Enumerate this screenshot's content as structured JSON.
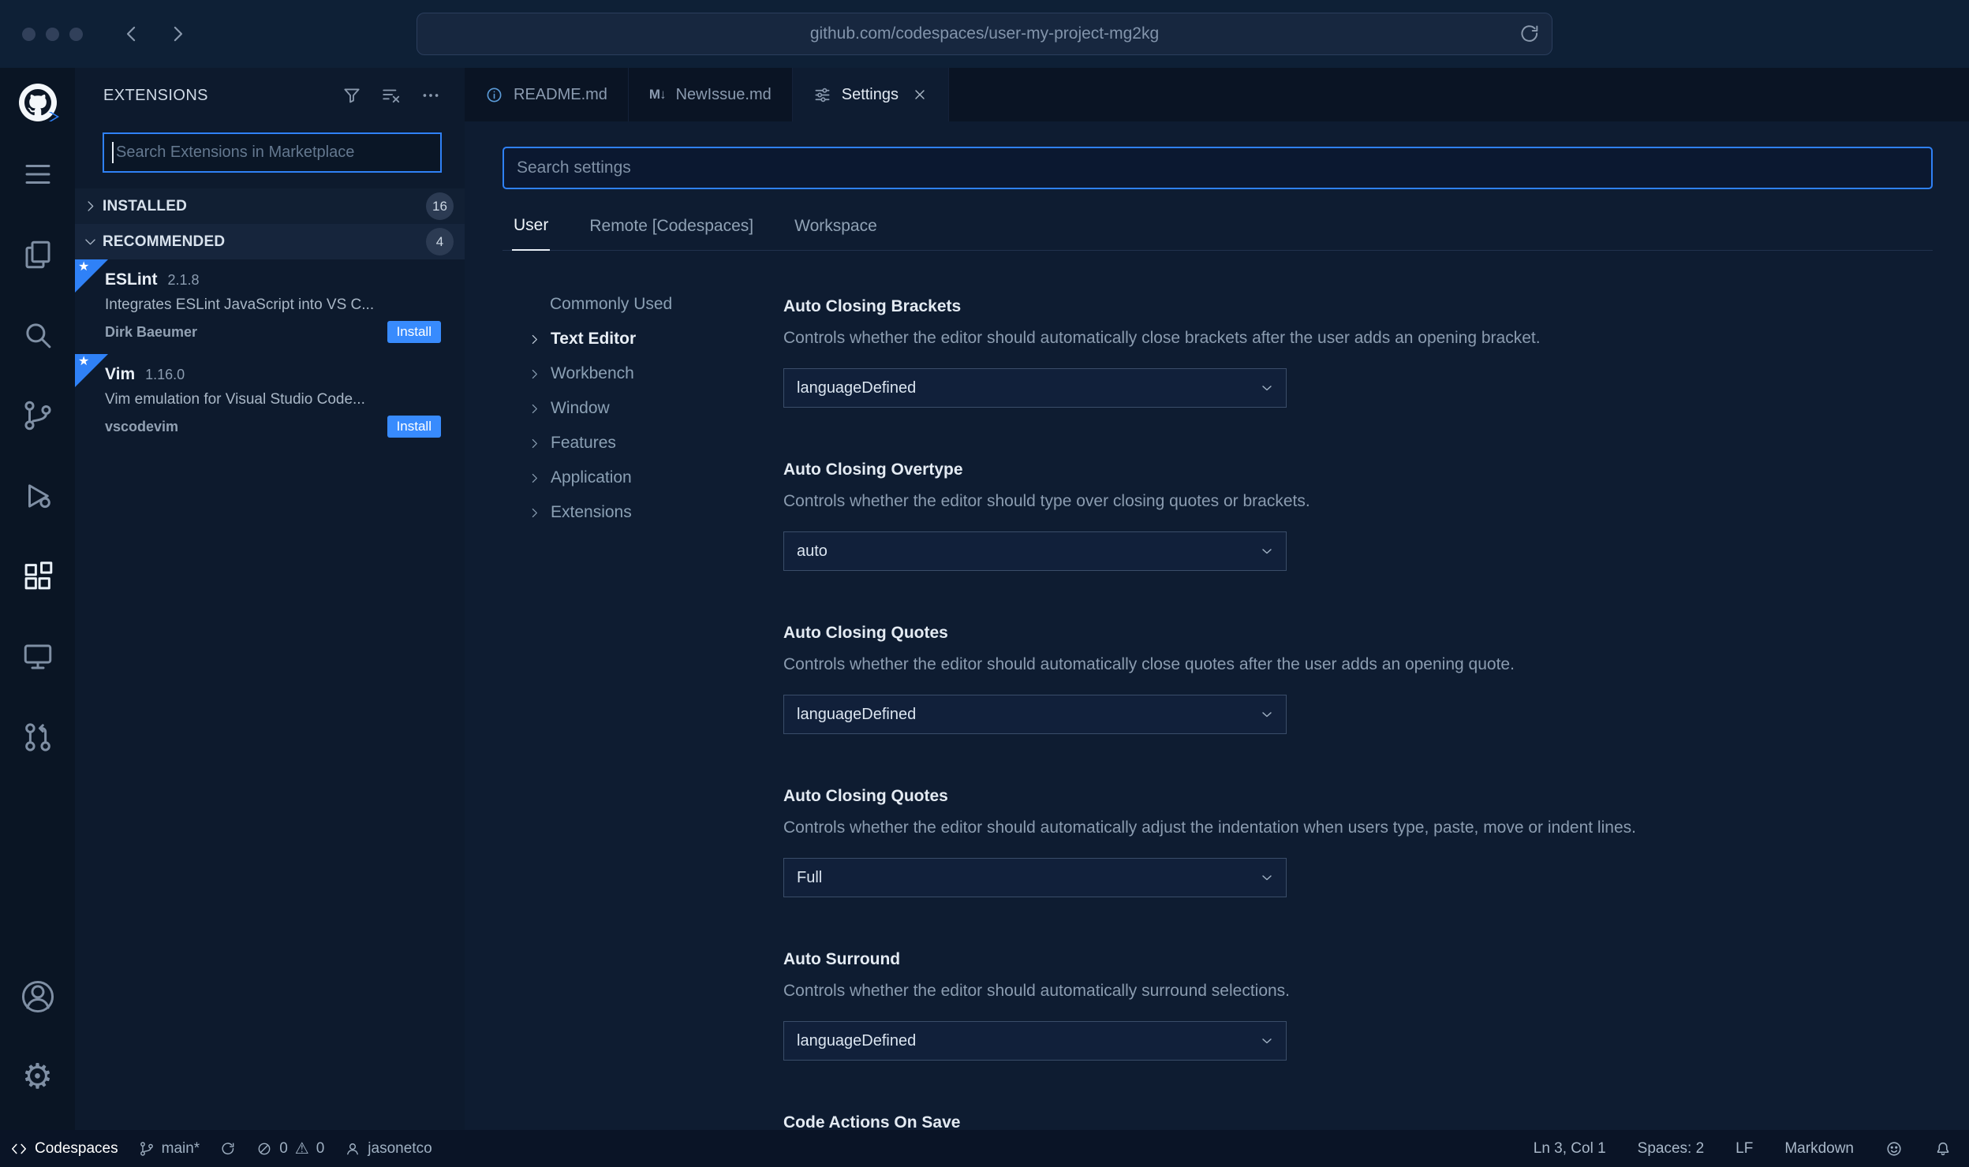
{
  "colors": {
    "accent_blue": "#2f81f7",
    "codespaces_blue": "#1f6feb",
    "install_blue": "#388bfd",
    "editor_bg": "#0e1c31",
    "chrome_bg": "#0e2036"
  },
  "browser": {
    "url": "github.com/codespaces/user-my-project-mg2kg"
  },
  "extensions_panel": {
    "title": "EXTENSIONS",
    "search_placeholder": "Search Extensions in Marketplace",
    "sections": [
      {
        "label": "INSTALLED",
        "count": "16"
      },
      {
        "label": "RECOMMENDED",
        "count": "4"
      }
    ],
    "items": [
      {
        "name": "ESLint",
        "version": "2.1.8",
        "description": "Integrates ESLint JavaScript into VS C...",
        "publisher": "Dirk Baeumer",
        "action": "Install"
      },
      {
        "name": "Vim",
        "version": "1.16.0",
        "description": "Vim emulation for Visual Studio Code...",
        "publisher": "vscodevim",
        "action": "Install"
      }
    ]
  },
  "editor_tabs": [
    {
      "label": "README.md"
    },
    {
      "label": "NewIssue.md"
    },
    {
      "label": "Settings"
    }
  ],
  "settings": {
    "search_placeholder": "Search settings",
    "scope_tabs": [
      {
        "label": "User"
      },
      {
        "label": "Remote [Codespaces]"
      },
      {
        "label": "Workspace"
      }
    ],
    "toc": [
      {
        "label": "Commonly Used"
      },
      {
        "label": "Text Editor"
      },
      {
        "label": "Workbench"
      },
      {
        "label": "Window"
      },
      {
        "label": "Features"
      },
      {
        "label": "Application"
      },
      {
        "label": "Extensions"
      }
    ],
    "entries": [
      {
        "title": "Auto Closing Brackets",
        "description": "Controls whether the editor should automatically close brackets after the user adds an opening bracket.",
        "value": "languageDefined"
      },
      {
        "title": "Auto Closing Overtype",
        "description": "Controls whether the editor should type over closing quotes or brackets.",
        "value": "auto"
      },
      {
        "title": "Auto Closing Quotes",
        "description": "Controls whether the editor should automatically close quotes after the user adds an opening quote.",
        "value": "languageDefined"
      },
      {
        "title": "Auto Closing Quotes",
        "description": "Controls whether the editor should automatically adjust the indentation when users type, paste, move or indent lines.",
        "value": "Full"
      },
      {
        "title": "Auto Surround",
        "description": "Controls whether the editor should automatically surround selections.",
        "value": "languageDefined"
      },
      {
        "title": "Code Actions On Save"
      }
    ]
  },
  "status_bar": {
    "codespaces_label": "Codespaces",
    "branch": "main*",
    "error_count": "0",
    "warning_count": "0",
    "user": "jasonetco",
    "cursor": "Ln 3, Col 1",
    "indent": "Spaces: 2",
    "eol": "LF",
    "language": "Markdown"
  },
  "glyphs": {
    "markdown_icon": "M↓",
    "gear": "⚙",
    "warning": "⚠",
    "star": "★"
  }
}
